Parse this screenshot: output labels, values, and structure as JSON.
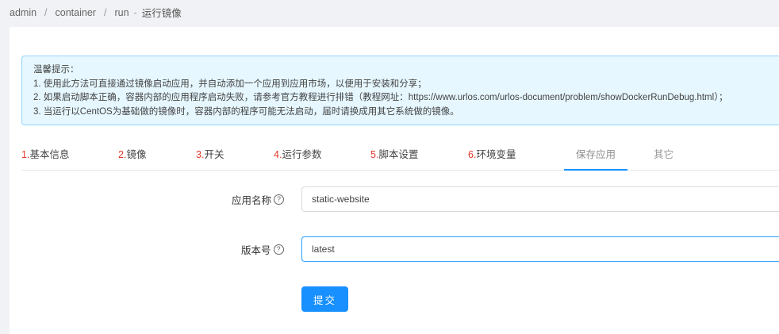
{
  "breadcrumb": {
    "items": [
      "admin",
      "container",
      "run"
    ],
    "separator": "/",
    "current_sep": "-",
    "current": "运行镜像"
  },
  "notice": {
    "title": "温馨提示：",
    "lines": [
      "1. 使用此方法可直接通过镜像启动应用，并自动添加一个应用到应用市场，以便用于安装和分享；",
      "2. 如果启动脚本正确，容器内部的应用程序启动失败，请参考官方教程进行排错（教程网址：https://www.urlos.com/urlos-document/problem/showDockerRunDebug.html）；",
      "3. 当运行以CentOS为基础做的镜像时，容器内部的程序可能无法启动，届时请换成用其它系统做的镜像。"
    ]
  },
  "tabs": [
    {
      "num": "1.",
      "label": "基本信息"
    },
    {
      "num": "2.",
      "label": "镜像"
    },
    {
      "num": "3.",
      "label": "开关"
    },
    {
      "num": "4.",
      "label": "运行参数"
    },
    {
      "num": "5.",
      "label": "脚本设置"
    },
    {
      "num": "6.",
      "label": "环境变量"
    },
    {
      "num": "",
      "label": "保存应用"
    },
    {
      "num": "",
      "label": "其它"
    }
  ],
  "form": {
    "app_name": {
      "label": "应用名称",
      "value": "static-website"
    },
    "version": {
      "label": "版本号",
      "value": "latest"
    },
    "help_glyph": "?",
    "submit_label": "提交"
  },
  "colors": {
    "accent": "#1890ff",
    "notice_bg": "#e6f7ff",
    "notice_border": "#91d5ff",
    "step_number": "#e4392b"
  }
}
